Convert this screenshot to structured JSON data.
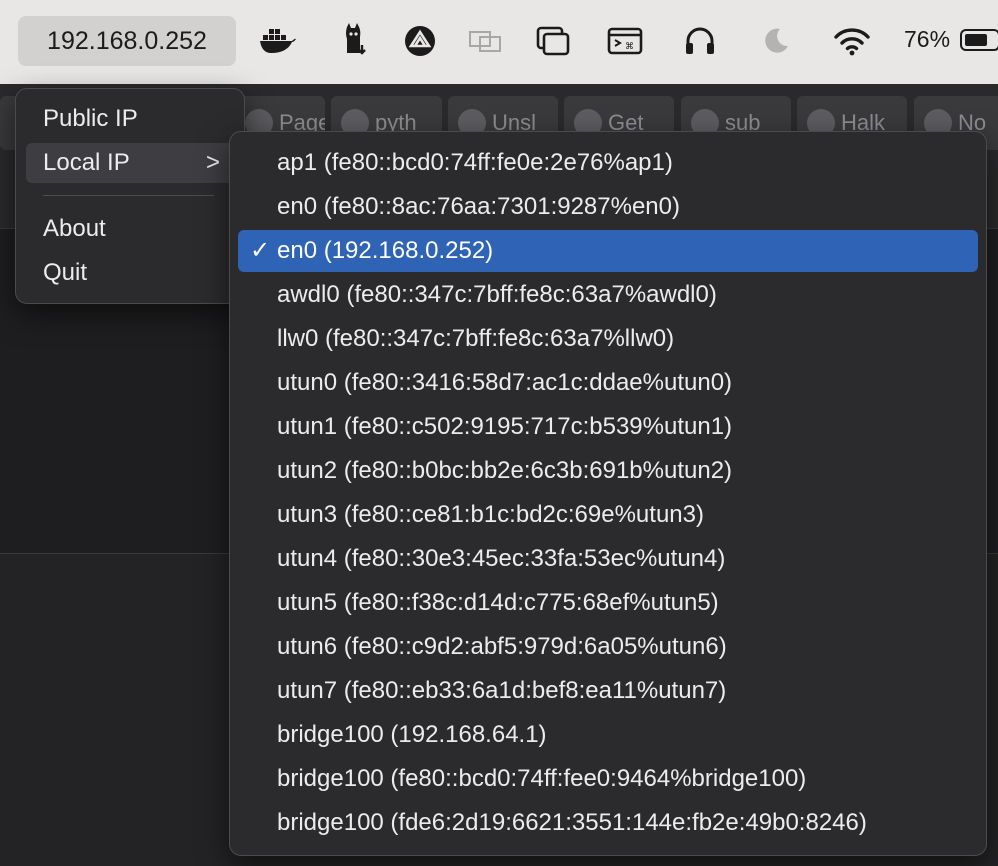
{
  "menubar": {
    "ip_label": "192.168.0.252",
    "icons": [
      "docker-icon",
      "alpaca-icon",
      "vpn-icon",
      "displays-icon",
      "windows-icon",
      "terminal-icon",
      "headphones-icon",
      "moon-icon",
      "wifi-icon"
    ],
    "battery_percent_label": "76%",
    "battery_level": 0.76
  },
  "background_tabs": [
    "Page",
    "pyth",
    "Unsl",
    "Get",
    "sub",
    "Halk",
    "No"
  ],
  "main_menu": {
    "items": [
      {
        "label": "Public IP"
      },
      {
        "label": "Local IP",
        "has_submenu": true
      },
      {
        "label": "About"
      },
      {
        "label": "Quit"
      }
    ],
    "submenu_chevron": ">"
  },
  "local_ip_submenu": {
    "check_mark": "✓",
    "selected_index": 2,
    "items": [
      "ap1 (fe80::bcd0:74ff:fe0e:2e76%ap1)",
      "en0 (fe80::8ac:76aa:7301:9287%en0)",
      "en0 (192.168.0.252)",
      "awdl0 (fe80::347c:7bff:fe8c:63a7%awdl0)",
      "llw0 (fe80::347c:7bff:fe8c:63a7%llw0)",
      "utun0 (fe80::3416:58d7:ac1c:ddae%utun0)",
      "utun1 (fe80::c502:9195:717c:b539%utun1)",
      "utun2 (fe80::b0bc:bb2e:6c3b:691b%utun2)",
      "utun3 (fe80::ce81:b1c:bd2c:69e%utun3)",
      "utun4 (fe80::30e3:45ec:33fa:53ec%utun4)",
      "utun5 (fe80::f38c:d14d:c775:68ef%utun5)",
      "utun6 (fe80::c9d2:abf5:979d:6a05%utun6)",
      "utun7 (fe80::eb33:6a1d:bef8:ea11%utun7)",
      "bridge100 (192.168.64.1)",
      "bridge100 (fe80::bcd0:74ff:fee0:9464%bridge100)",
      "bridge100 (fde6:2d19:6621:3551:144e:fb2e:49b0:8246)"
    ]
  },
  "colors": {
    "selection": "#2f63b5",
    "menu_bg": "#2b2b2e",
    "menubar_bg": "#e9e7e6"
  }
}
